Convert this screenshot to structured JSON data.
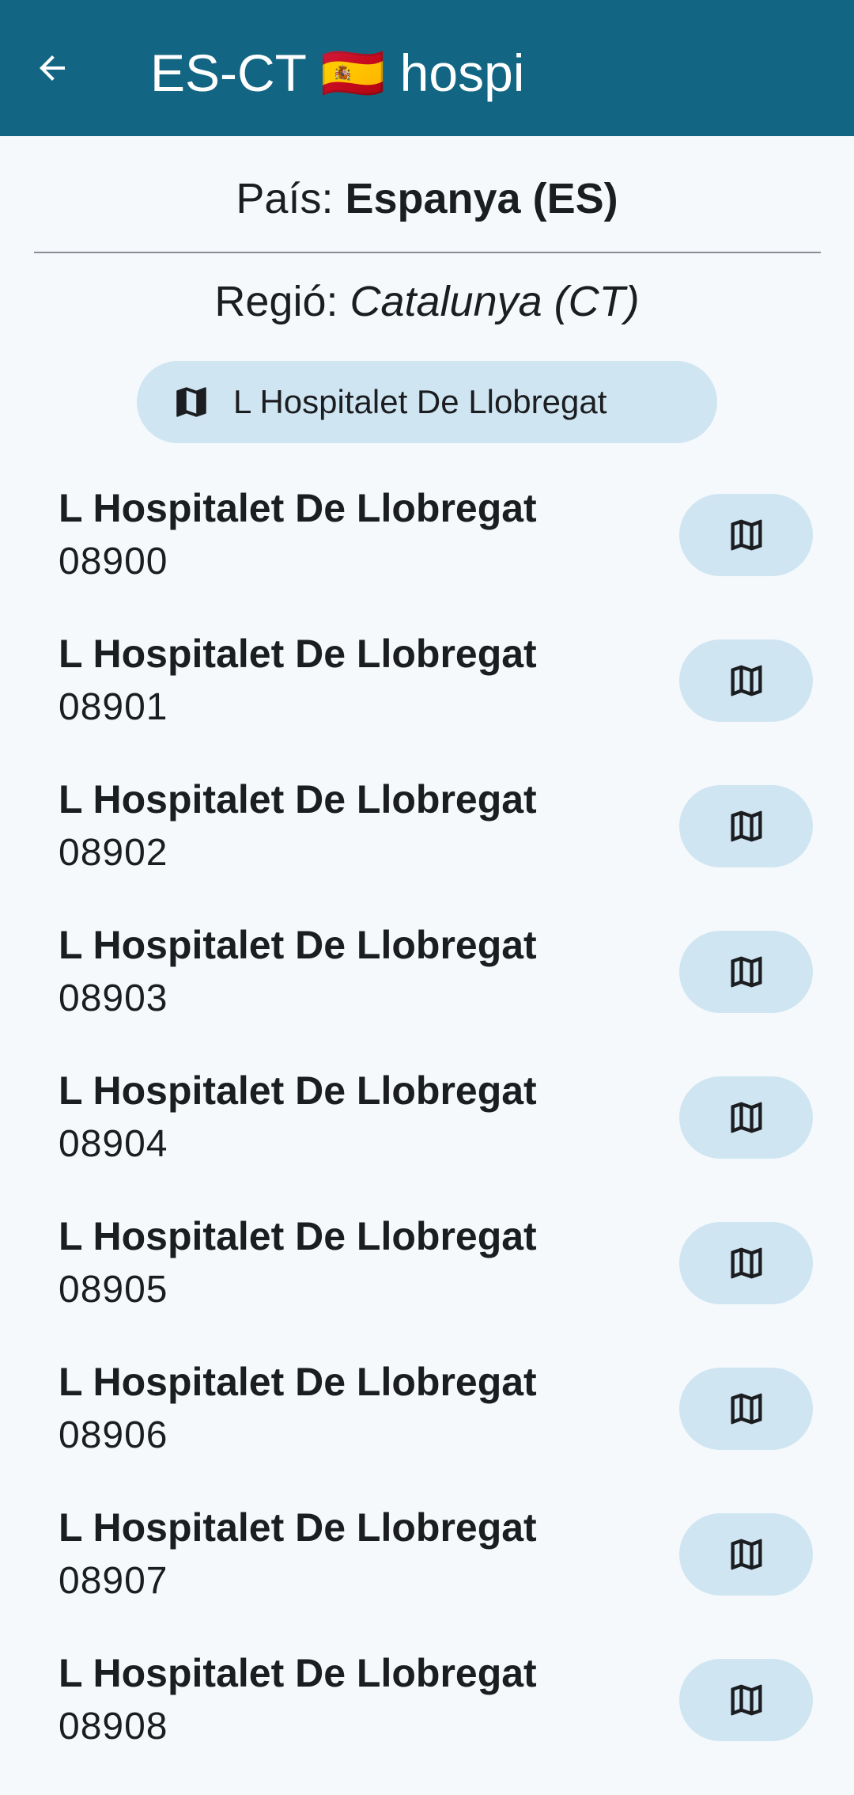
{
  "app_bar": {
    "back_icon": "arrow-back-icon",
    "title": "ES-CT 🇪🇸 hospi"
  },
  "header": {
    "country_label": "País: ",
    "country_value": "Espanya (ES)",
    "region_label": "Regió: ",
    "region_value": "Catalunya (CT)",
    "city_chip_label": "L Hospitalet De Llobregat",
    "city_chip_icon": "map-icon"
  },
  "colors": {
    "app_bar": "#136683",
    "background": "#f5f9fc",
    "chip": "#cfe5f2",
    "text": "#1b1d20"
  },
  "items": [
    {
      "name": "L Hospitalet De Llobregat",
      "code": "08900"
    },
    {
      "name": "L Hospitalet De Llobregat",
      "code": "08901"
    },
    {
      "name": "L Hospitalet De Llobregat",
      "code": "08902"
    },
    {
      "name": "L Hospitalet De Llobregat",
      "code": "08903"
    },
    {
      "name": "L Hospitalet De Llobregat",
      "code": "08904"
    },
    {
      "name": "L Hospitalet De Llobregat",
      "code": "08905"
    },
    {
      "name": "L Hospitalet De Llobregat",
      "code": "08906"
    },
    {
      "name": "L Hospitalet De Llobregat",
      "code": "08907"
    },
    {
      "name": "L Hospitalet De Llobregat",
      "code": "08908"
    }
  ]
}
